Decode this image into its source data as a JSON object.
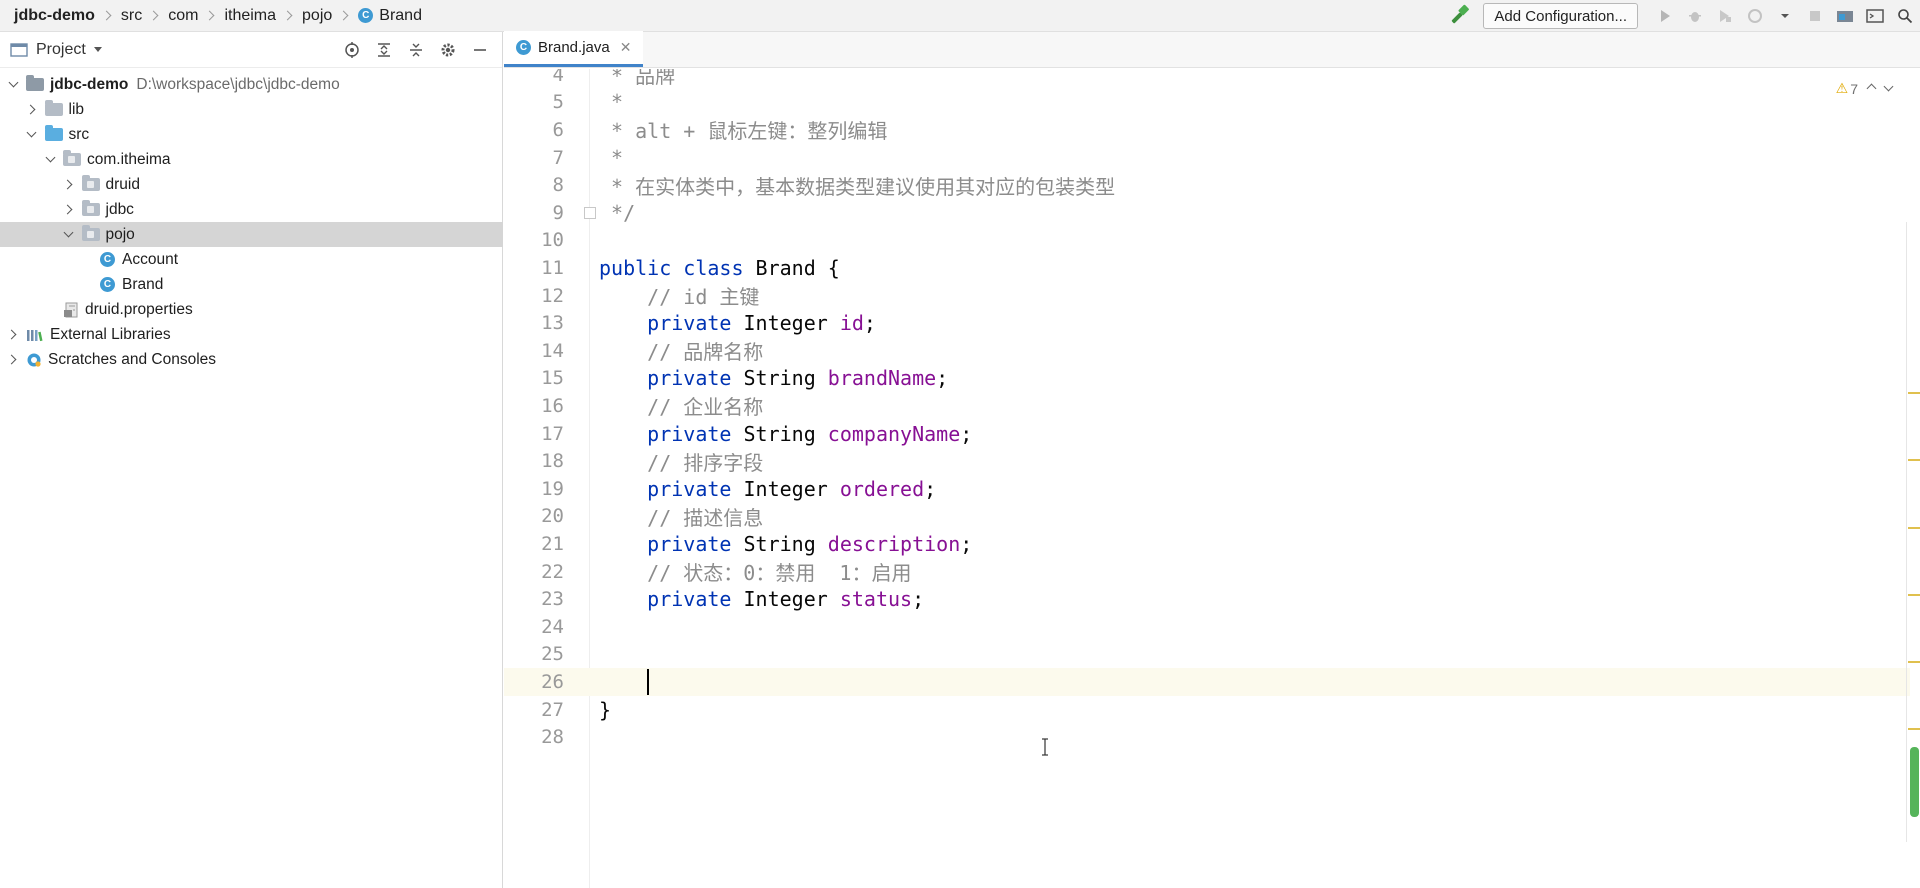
{
  "breadcrumb": {
    "items": [
      {
        "label": "jdbc-demo",
        "bold": true
      },
      {
        "label": "src"
      },
      {
        "label": "com"
      },
      {
        "label": "itheima"
      },
      {
        "label": "pojo"
      },
      {
        "label": "Brand",
        "icon": "class-icon"
      }
    ]
  },
  "toolbar": {
    "config_label": "Add Configuration..."
  },
  "project": {
    "title": "Project",
    "tree": [
      {
        "label": "jdbc-demo",
        "path": "D:\\workspace\\jdbc\\jdbc-demo",
        "depth": 0,
        "expanded": true,
        "type": "module"
      },
      {
        "label": "lib",
        "depth": 1,
        "expanded": false,
        "type": "folder"
      },
      {
        "label": "src",
        "depth": 1,
        "expanded": true,
        "type": "src"
      },
      {
        "label": "com.itheima",
        "depth": 2,
        "expanded": true,
        "type": "package"
      },
      {
        "label": "druid",
        "depth": 3,
        "expanded": false,
        "type": "package"
      },
      {
        "label": "jdbc",
        "depth": 3,
        "expanded": false,
        "type": "package"
      },
      {
        "label": "pojo",
        "depth": 3,
        "expanded": true,
        "type": "package",
        "selected": true
      },
      {
        "label": "Account",
        "depth": 4,
        "type": "class"
      },
      {
        "label": "Brand",
        "depth": 4,
        "type": "class"
      },
      {
        "label": "druid.properties",
        "depth": 2,
        "type": "properties"
      },
      {
        "label": "External Libraries",
        "depth": 0,
        "expanded": false,
        "type": "libraries"
      },
      {
        "label": "Scratches and Consoles",
        "depth": 0,
        "expanded": false,
        "type": "scratches"
      }
    ]
  },
  "editor": {
    "tab_label": "Brand.java",
    "warning_count": "7",
    "current_line": 26,
    "lines": [
      {
        "n": "4",
        "parts": [
          [
            "cm",
            " * 品牌"
          ]
        ]
      },
      {
        "n": "5",
        "parts": [
          [
            "cm",
            " *"
          ]
        ]
      },
      {
        "n": "6",
        "parts": [
          [
            "cm",
            " * alt + 鼠标左键：整列编辑"
          ]
        ]
      },
      {
        "n": "7",
        "parts": [
          [
            "cm",
            " *"
          ]
        ]
      },
      {
        "n": "8",
        "parts": [
          [
            "cm",
            " * 在实体类中，基本数据类型建议使用其对应的包装类型"
          ]
        ]
      },
      {
        "n": "9",
        "parts": [
          [
            "cm",
            " */"
          ]
        ]
      },
      {
        "n": "10",
        "parts": []
      },
      {
        "n": "11",
        "parts": [
          [
            "kw",
            "public class "
          ],
          [
            "tx",
            "Brand {"
          ]
        ]
      },
      {
        "n": "12",
        "parts": [
          [
            "cm",
            "    // id 主键"
          ]
        ]
      },
      {
        "n": "13",
        "parts": [
          [
            "kw",
            "    private "
          ],
          [
            "tx",
            "Integer "
          ],
          [
            "fld",
            "id"
          ],
          [
            "tx",
            ";"
          ]
        ]
      },
      {
        "n": "14",
        "parts": [
          [
            "cm",
            "    // 品牌名称"
          ]
        ]
      },
      {
        "n": "15",
        "parts": [
          [
            "kw",
            "    private "
          ],
          [
            "tx",
            "String "
          ],
          [
            "fld",
            "brandName"
          ],
          [
            "tx",
            ";"
          ]
        ]
      },
      {
        "n": "16",
        "parts": [
          [
            "cm",
            "    // 企业名称"
          ]
        ]
      },
      {
        "n": "17",
        "parts": [
          [
            "kw",
            "    private "
          ],
          [
            "tx",
            "String "
          ],
          [
            "fld",
            "companyName"
          ],
          [
            "tx",
            ";"
          ]
        ]
      },
      {
        "n": "18",
        "parts": [
          [
            "cm",
            "    // 排序字段"
          ]
        ]
      },
      {
        "n": "19",
        "parts": [
          [
            "kw",
            "    private "
          ],
          [
            "tx",
            "Integer "
          ],
          [
            "fld",
            "ordered"
          ],
          [
            "tx",
            ";"
          ]
        ]
      },
      {
        "n": "20",
        "parts": [
          [
            "cm",
            "    // 描述信息"
          ]
        ]
      },
      {
        "n": "21",
        "parts": [
          [
            "kw",
            "    private "
          ],
          [
            "tx",
            "String "
          ],
          [
            "fld",
            "description"
          ],
          [
            "tx",
            ";"
          ]
        ]
      },
      {
        "n": "22",
        "parts": [
          [
            "cm",
            "    // 状态：0：禁用  1：启用"
          ]
        ]
      },
      {
        "n": "23",
        "parts": [
          [
            "kw",
            "    private "
          ],
          [
            "tx",
            "Integer "
          ],
          [
            "fld",
            "status"
          ],
          [
            "tx",
            ";"
          ]
        ]
      },
      {
        "n": "24",
        "parts": []
      },
      {
        "n": "25",
        "parts": []
      },
      {
        "n": "26",
        "parts": [
          [
            "tx",
            "    "
          ]
        ],
        "caret": true
      },
      {
        "n": "27",
        "parts": [
          [
            "tx",
            "}"
          ]
        ]
      },
      {
        "n": "28",
        "parts": []
      }
    ]
  },
  "colors": {
    "keyword": "#0033b3",
    "comment": "#8c8c8c",
    "field": "#871094",
    "class_icon": "#3e9ad3",
    "tab_underline": "#4083c9"
  }
}
